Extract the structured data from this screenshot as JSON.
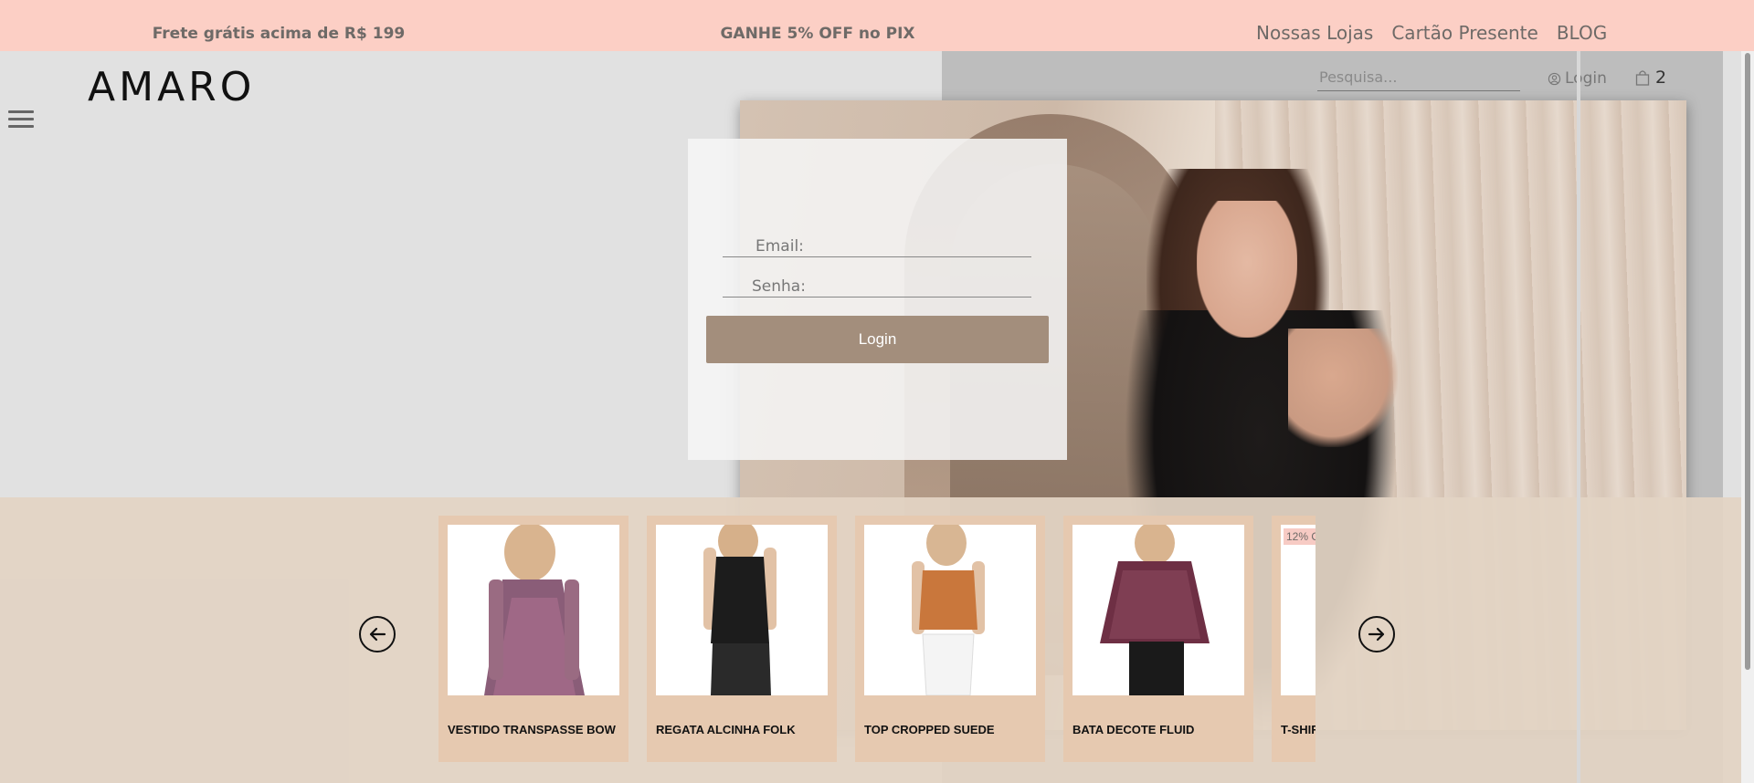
{
  "promo": {
    "shipping": "Frete grátis acima de R$ 199",
    "pix": "GANHE 5% OFF no PIX"
  },
  "top_links": [
    "Nossas Lojas",
    "Cartão Presente",
    "BLOG"
  ],
  "header": {
    "logo": "AMARO",
    "search_placeholder": "Pesquisa...",
    "login_label": "Login",
    "cart_count": "2"
  },
  "login_form": {
    "email_label": "Email:",
    "password_label": "Senha:",
    "submit_label": "Login"
  },
  "products": [
    {
      "name": "VESTIDO TRANSPASSE BOW",
      "badge": ""
    },
    {
      "name": "REGATA ALCINHA FOLK",
      "badge": ""
    },
    {
      "name": "TOP CROPPED SUEDE",
      "badge": ""
    },
    {
      "name": "BATA DECOTE FLUID",
      "badge": ""
    },
    {
      "name": "T-SHIR",
      "badge": "12% O"
    }
  ],
  "colors": {
    "promo_bar": "#fccfc5",
    "accent_button": "#a38e7c",
    "product_strip": "#e2d3c4"
  }
}
